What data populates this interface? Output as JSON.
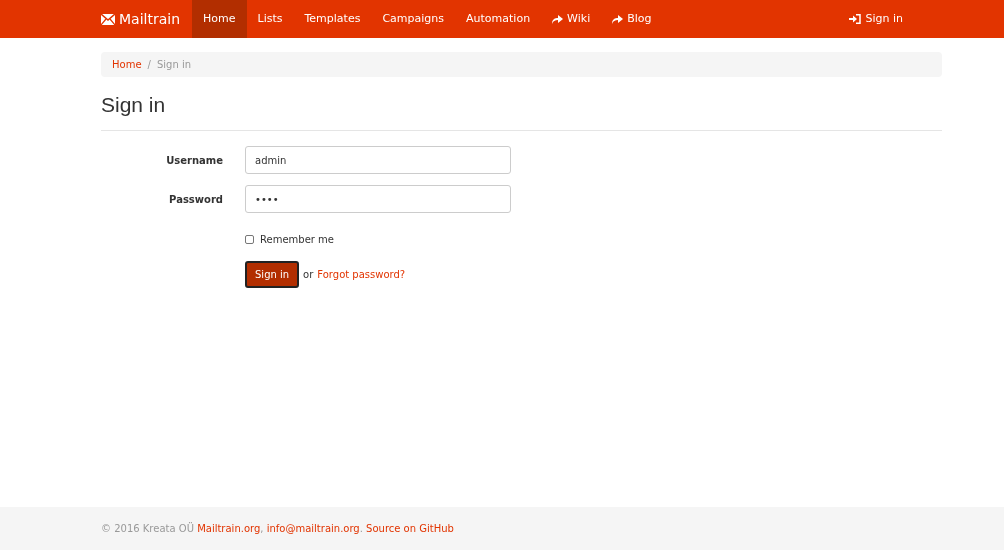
{
  "navbar": {
    "brand": "Mailtrain",
    "items": [
      {
        "label": "Home",
        "kind": "link",
        "selected": true
      },
      {
        "label": "Lists",
        "kind": "link",
        "selected": false
      },
      {
        "label": "Templates",
        "kind": "link",
        "selected": false
      },
      {
        "label": "Campaigns",
        "kind": "link",
        "selected": false
      },
      {
        "label": "Automation",
        "kind": "link",
        "selected": false
      },
      {
        "label": "Wiki",
        "kind": "external",
        "selected": false
      },
      {
        "label": "Blog",
        "kind": "external",
        "selected": false
      }
    ],
    "sign_in": "Sign in"
  },
  "breadcrumb": [
    {
      "label": "Home",
      "kind": "link"
    },
    {
      "label": "/",
      "kind": "separator"
    },
    {
      "label": "Sign in",
      "kind": "current"
    }
  ],
  "heading": "Sign in",
  "form": {
    "fields": [
      {
        "label": "Username",
        "value": "admin"
      },
      {
        "label": "Password",
        "value": "••••"
      }
    ],
    "remember": {
      "label": "Remember me",
      "checked": false
    },
    "submit": "Sign in",
    "or": "or",
    "forgot": "Forgot password?"
  },
  "footer": [
    {
      "text": "© 2016 Kreata OÜ ",
      "kind": "text"
    },
    {
      "text": "Mailtrain.org",
      "kind": "link"
    },
    {
      "text": ", ",
      "kind": "text"
    },
    {
      "text": "info@mailtrain.org",
      "kind": "link"
    },
    {
      "text": ". ",
      "kind": "text"
    },
    {
      "text": "Source on GitHub",
      "kind": "link"
    }
  ]
}
